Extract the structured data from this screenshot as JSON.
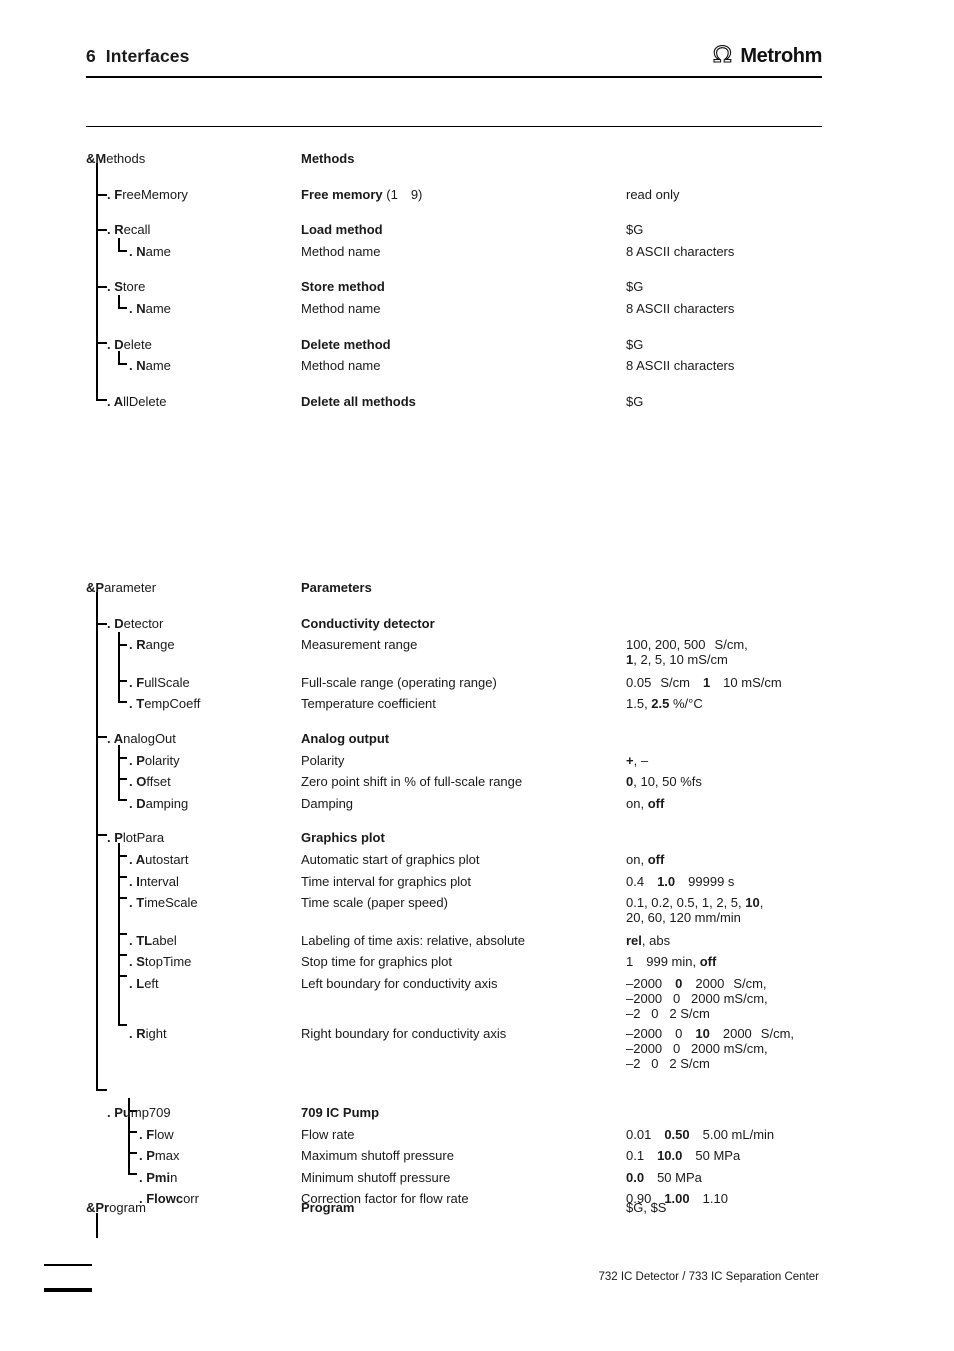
{
  "header": {
    "chapter_number": "6",
    "chapter_title": "Interfaces",
    "brand": "Metrohm",
    "logo_icon": "metrohm-omega-icon"
  },
  "footer": {
    "document_title": "732 IC Detector / 733 IC Separation Center"
  },
  "sections": [
    {
      "id": "methods",
      "root_tree_bold": "&M",
      "root_tree_rest": "ethods",
      "root_desc": "Methods",
      "root_value": "",
      "rows": [
        {
          "tree_prefix": ". ",
          "tree_bold": "F",
          "tree_rest": "reeMemory",
          "desc_bold": "Free memory",
          "desc_rest": " (1",
          "desc_tail": "9)",
          "value": "read only"
        },
        {
          "tree_prefix": ". ",
          "tree_bold": "R",
          "tree_rest": "ecall",
          "desc_bold": "Load method",
          "value": "$G"
        },
        {
          "tree_prefix": ". ",
          "tree_bold": "N",
          "tree_rest": "ame",
          "desc": "Method name",
          "value": "8 ASCII characters"
        },
        {
          "tree_prefix": ". ",
          "tree_bold": "S",
          "tree_rest": "tore",
          "desc_bold": "Store method",
          "value": "$G"
        },
        {
          "tree_prefix": ". ",
          "tree_bold": "N",
          "tree_rest": "ame",
          "desc": "Method name",
          "value": "8 ASCII characters"
        },
        {
          "tree_prefix": ". ",
          "tree_bold": "D",
          "tree_rest": "elete",
          "desc_bold": "Delete method",
          "value": "$G"
        },
        {
          "tree_prefix": ". ",
          "tree_bold": "N",
          "tree_rest": "ame",
          "desc": "Method name",
          "value": "8 ASCII characters"
        },
        {
          "tree_prefix": ". ",
          "tree_bold": "A",
          "tree_rest": "llDelete",
          "desc_bold": "Delete all methods",
          "value": "$G"
        }
      ]
    },
    {
      "id": "parameter",
      "root_tree_bold": "&P",
      "root_tree_rest": "arameter",
      "root_desc": "Parameters",
      "root_value": "",
      "groups": [
        {
          "tree_prefix": ". ",
          "tree_bold": "D",
          "tree_rest": "etector",
          "desc_bold": "Conductivity detector",
          "rows": [
            {
              "tree_bold": "R",
              "tree_rest": "ange",
              "desc": "Measurement range",
              "value_line1_a": "100, 200, 500",
              "value_line1_b": "S/cm,",
              "value_line2_bold": "1",
              "value_line2_rest": ", 2, 5, 10 mS/cm"
            },
            {
              "tree_bold": "F",
              "tree_rest": "ullScale",
              "desc": "Full-scale range (operating range)",
              "value_a": "0.05",
              "value_b": "S/cm",
              "value_bold": "1",
              "value_c": "10 mS/cm"
            },
            {
              "tree_bold": "T",
              "tree_rest": "empCoeff",
              "desc": "Temperature coefficient",
              "value_a": "1.5, ",
              "value_bold": "2.5",
              "value_c": " %/°C"
            }
          ]
        },
        {
          "tree_prefix": ". ",
          "tree_bold": "A",
          "tree_rest": "nalogOut",
          "desc_bold": "Analog output",
          "rows": [
            {
              "tree_bold": "P",
              "tree_rest": "olarity",
              "desc": "Polarity",
              "value_bold": "+",
              "value_c": ", –"
            },
            {
              "tree_bold": "O",
              "tree_rest": "ffset",
              "desc": "Zero point shift in % of full-scale range",
              "value_bold": "0",
              "value_c": ", 10, 50 %fs"
            },
            {
              "tree_bold": "D",
              "tree_rest": "amping",
              "desc": "Damping",
              "value_a": "on, ",
              "value_bold": "off"
            }
          ]
        },
        {
          "tree_prefix": ". ",
          "tree_bold": "P",
          "tree_rest": "lotPara",
          "desc_bold": "Graphics plot",
          "rows": [
            {
              "tree_bold": "A",
              "tree_rest": "utostart",
              "desc": "Automatic start of graphics plot",
              "value_a": "on, ",
              "value_bold": "off"
            },
            {
              "tree_bold": "I",
              "tree_rest": "nterval",
              "desc": "Time interval for graphics plot",
              "value_a": "0.4",
              "value_bold": "1.0",
              "value_c": "99999 s"
            },
            {
              "tree_bold": "T",
              "tree_rest": "imeScale",
              "desc": "Time scale (paper speed)",
              "value_line1_a": "0.1, 0.2, 0.5, 1, 2, 5, ",
              "value_line1_bold": "10",
              "value_line1_c": ",",
              "value_line2": "20, 60, 120 mm/min"
            },
            {
              "tree_bold": "TL",
              "tree_rest": "abel",
              "desc": "Labeling of time axis: relative, absolute",
              "value_bold": "rel",
              "value_c": ", abs"
            },
            {
              "tree_bold": "S",
              "tree_rest": "topTime",
              "desc": "Stop time for graphics plot",
              "value_a": "1",
              "value_b": "999 min, ",
              "value_bold": "off"
            },
            {
              "tree_bold": "L",
              "tree_rest": "eft",
              "desc": "Left boundary for conductivity axis",
              "value_l1_a": "–2000",
              "value_l1_bold": "0",
              "value_l1_b": "2000",
              "value_l1_c": "S/cm,",
              "value_l2": "–2000   0   2000 mS/cm,",
              "value_l3": "–2   0   2 S/cm"
            },
            {
              "tree_bold": "R",
              "tree_rest": "ight",
              "desc": "Right boundary for conductivity axis",
              "value_l1_a": "–2000",
              "value_l1_zero": "0",
              "value_l1_bold": "10",
              "value_l1_b": "2000",
              "value_l1_c": "S/cm,",
              "value_l2": "–2000   0   2000 mS/cm,",
              "value_l3": "–2   0   2 S/cm"
            }
          ]
        },
        {
          "tree_prefix": ". ",
          "tree_bold": "Pu",
          "tree_rest": "mp709",
          "desc_bold": "709 IC Pump",
          "rows": [
            {
              "tree_bold": "F",
              "tree_rest": "low",
              "desc": "Flow rate",
              "value_a": "0.01",
              "value_bold": "0.50",
              "value_c": "5.00 mL/min"
            },
            {
              "tree_bold": "P",
              "tree_rest": "max",
              "desc": "Maximum shutoff pressure",
              "value_a": "0.1",
              "value_bold": "10.0",
              "value_c": "50 MPa"
            },
            {
              "tree_bold": "Pmi",
              "tree_rest": "n",
              "desc": "Minimum shutoff pressure",
              "value_bold": "0.0",
              "value_c": "50 MPa"
            },
            {
              "tree_bold": "Flowc",
              "tree_rest": "orr",
              "desc": "Correction factor for flow rate",
              "value_a": "0.90",
              "value_bold": "1.00",
              "value_c": "1.10"
            }
          ]
        }
      ]
    },
    {
      "id": "program",
      "root_tree_bold": "&Pr",
      "root_tree_rest": "ogram",
      "root_desc": "Program",
      "root_value": "$G, $S"
    }
  ]
}
